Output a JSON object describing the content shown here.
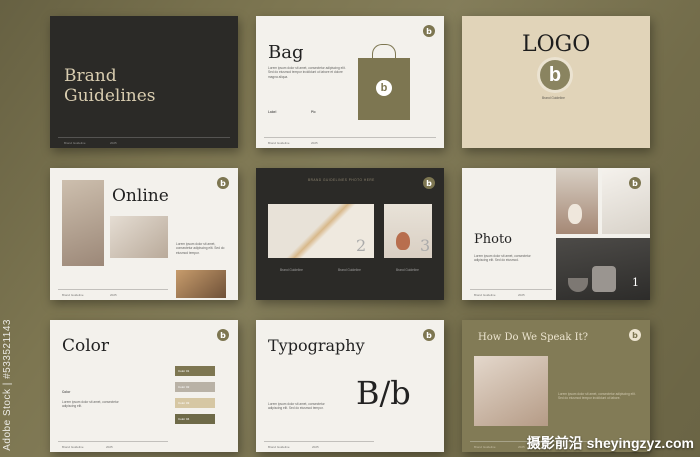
{
  "slides": {
    "brand": {
      "title": "Brand Guidelines",
      "title_line1": "Brand",
      "title_line2": "Guidelines",
      "footer_left": "Brand Guideline",
      "footer_right": "2025"
    },
    "bag": {
      "title": "Bag",
      "logo_letter": "b",
      "body": "Lorem ipsum dolor sit amet, consectetur adipiscing elit. Sed do eiusmod tempor incididunt ut labore et dolore magna aliqua.",
      "label_1": "Label",
      "label_2": "Pic",
      "footer_left": "Brand Guideline",
      "footer_right": "2025"
    },
    "logo": {
      "title": "LOGO",
      "logo_letter": "b",
      "caption": "Brand Guideline"
    },
    "online": {
      "title": "Online",
      "logo_letter": "b",
      "body": "Lorem ipsum dolor sit amet, consectetur adipiscing elit. Sed do eiusmod tempor.",
      "footer_left": "Brand Guideline",
      "footer_right": "2025"
    },
    "photo_dark": {
      "header": "BRAND GUIDELINES PHOTO HERE",
      "num_2": "2",
      "num_3": "3",
      "cap_1": "Brand Guideline",
      "cap_2": "Brand Guideline",
      "cap_3": "Brand Guideline",
      "logo_letter": "b"
    },
    "photo": {
      "title": "Photo",
      "logo_letter": "b",
      "body": "Lorem ipsum dolor sit amet, consectetur adipiscing elit. Sed do eiusmod.",
      "num": "1",
      "footer_left": "Brand Guideline",
      "footer_right": "2025"
    },
    "color": {
      "title": "Color",
      "logo_letter": "b",
      "label": "Color",
      "body": "Lorem ipsum dolor sit amet, consectetur adipiscing elit.",
      "swatches": [
        "Color 01",
        "Color 02",
        "Color 03",
        "Color 04"
      ],
      "footer_left": "Brand Guideline",
      "footer_right": "2025"
    },
    "typography": {
      "title": "Typography",
      "logo_letter": "b",
      "sample": "B/b",
      "body": "Lorem ipsum dolor sit amet, consectetur adipiscing elit. Sed do eiusmod tempor.",
      "footer_left": "Brand Guideline",
      "footer_right": "2025"
    },
    "speak": {
      "title": "How Do We Speak It?",
      "logo_letter": "b",
      "body": "Lorem ipsum dolor sit amet, consectetur adipiscing elit. Sed do eiusmod tempor incididunt ut labore.",
      "footer_left": "Brand Guideline",
      "footer_right": "2025"
    }
  },
  "watermark": {
    "side": "Adobe Stock | #533521143",
    "corner": "摄影前沿 sheyingzyz.com"
  },
  "colors": {
    "olive": "#7d7651",
    "dark": "#2b2a27",
    "beige": "#e1d4b9",
    "light": "#f3f1ec"
  }
}
